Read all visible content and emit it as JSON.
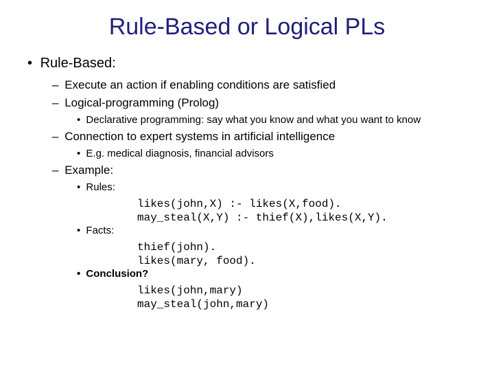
{
  "title": "Rule-Based or Logical PLs",
  "l1_rule_based": "Rule-Based:",
  "l2_execute": "Execute an action if enabling conditions are satisfied",
  "l2_logical": "Logical-programming (Prolog)",
  "l3_declarative": "Declarative programming: say what you know and what you want to know",
  "l2_connection": "Connection to expert systems in artificial intelligence",
  "l3_eg": "E.g. medical diagnosis, financial advisors",
  "l2_example": "Example:",
  "l3_rules": "Rules:",
  "code_rules1": "likes(john,X) :- likes(X,food).",
  "code_rules2": "may_steal(X,Y) :- thief(X),likes(X,Y).",
  "l3_facts": "Facts:",
  "code_facts1": "thief(john).",
  "code_facts2": "likes(mary, food).",
  "l3_conclusion": "Conclusion?",
  "code_conc1": "likes(john,mary)",
  "code_conc2": "may_steal(john,mary)"
}
